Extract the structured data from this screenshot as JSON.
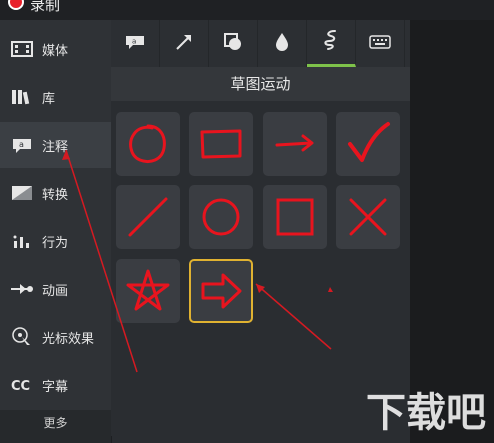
{
  "window": {
    "title": "录制"
  },
  "sidebar": {
    "items": [
      {
        "label": "媒体",
        "icon": "film-icon"
      },
      {
        "label": "库",
        "icon": "library-icon"
      },
      {
        "label": "注释",
        "icon": "annotation-icon"
      },
      {
        "label": "转换",
        "icon": "transition-icon"
      },
      {
        "label": "行为",
        "icon": "behavior-icon"
      },
      {
        "label": "动画",
        "icon": "animation-icon"
      },
      {
        "label": "光标效果",
        "icon": "cursor-effect-icon"
      },
      {
        "label": "字幕",
        "icon": "captions-icon"
      }
    ],
    "active_index": 2,
    "more_label": "更多"
  },
  "tabs": [
    {
      "icon": "callout-icon"
    },
    {
      "icon": "arrow-icon"
    },
    {
      "icon": "shape-icon"
    },
    {
      "icon": "blur-drop-icon"
    },
    {
      "icon": "sketch-motion-icon",
      "active": true
    },
    {
      "icon": "keyboard-icon"
    }
  ],
  "panel": {
    "title": "草图运动"
  },
  "tiles": [
    {
      "icon": "circle-sketch-icon"
    },
    {
      "icon": "rectangle-sketch-icon"
    },
    {
      "icon": "arrow-sketch-icon"
    },
    {
      "icon": "check-sketch-icon"
    },
    {
      "icon": "line-sketch-icon"
    },
    {
      "icon": "circle-icon"
    },
    {
      "icon": "square-icon"
    },
    {
      "icon": "x-mark-icon"
    },
    {
      "icon": "star-sketch-icon"
    },
    {
      "icon": "block-arrow-icon",
      "selected": true
    }
  ],
  "colors": {
    "accent_green": "#7ec24a",
    "sketch_red": "#e8141e",
    "selection_yellow": "#e0b231"
  },
  "watermark": {
    "text": "下载吧"
  }
}
